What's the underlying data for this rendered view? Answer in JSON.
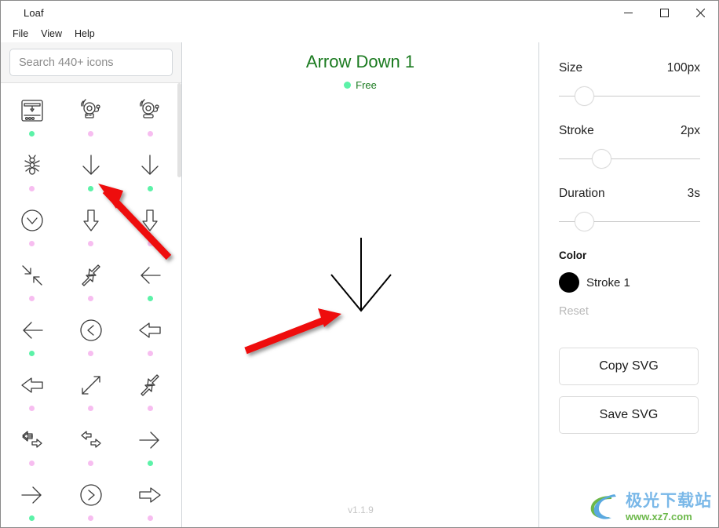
{
  "window": {
    "title": "Loaf",
    "controls": {
      "minimize": "─",
      "maximize": "□",
      "close": "✕"
    }
  },
  "menubar": {
    "items": [
      {
        "label": "File",
        "name": "menu-file"
      },
      {
        "label": "View",
        "name": "menu-view"
      },
      {
        "label": "Help",
        "name": "menu-help"
      }
    ]
  },
  "sidebar": {
    "search": {
      "placeholder": "Search 440+ icons",
      "value": ""
    },
    "icons": [
      {
        "name": "3d-printer-icon",
        "tier": "free"
      },
      {
        "name": "alarm-bell-icon",
        "tier": "pro"
      },
      {
        "name": "alarm-bell-2-icon",
        "tier": "pro"
      },
      {
        "name": "ant-icon",
        "tier": "pro"
      },
      {
        "name": "arrow-down-1-icon",
        "tier": "free"
      },
      {
        "name": "arrow-down-2-icon",
        "tier": "free"
      },
      {
        "name": "arrow-down-circle-icon",
        "tier": "pro"
      },
      {
        "name": "arrow-down-block-icon",
        "tier": "pro"
      },
      {
        "name": "arrow-down-block-2-icon",
        "tier": "pro"
      },
      {
        "name": "arrow-collapse-diagonal-icon",
        "tier": "pro"
      },
      {
        "name": "arrow-expand-diagonal-block-icon",
        "tier": "pro"
      },
      {
        "name": "arrow-left-1-icon",
        "tier": "free"
      },
      {
        "name": "arrow-left-2-icon",
        "tier": "free"
      },
      {
        "name": "arrow-left-circle-icon",
        "tier": "pro"
      },
      {
        "name": "arrow-left-block-icon",
        "tier": "pro"
      },
      {
        "name": "arrow-left-block-2-icon",
        "tier": "pro"
      },
      {
        "name": "arrow-expand-diagonal-icon",
        "tier": "pro"
      },
      {
        "name": "arrow-expand-diagonal-2-icon",
        "tier": "pro"
      },
      {
        "name": "arrow-left-right-block-icon",
        "tier": "pro"
      },
      {
        "name": "arrow-left-right-block-2-icon",
        "tier": "pro"
      },
      {
        "name": "arrow-right-1-icon",
        "tier": "free"
      },
      {
        "name": "arrow-right-2-icon",
        "tier": "free"
      },
      {
        "name": "arrow-right-circle-icon",
        "tier": "pro"
      },
      {
        "name": "arrow-right-block-icon",
        "tier": "pro"
      }
    ]
  },
  "preview": {
    "title": "Arrow Down 1",
    "badge": "Free",
    "version": "v1.1.9"
  },
  "panel": {
    "size": {
      "label": "Size",
      "value": "100px",
      "thumb_pct": 18
    },
    "stroke": {
      "label": "Stroke",
      "value": "2px",
      "thumb_pct": 30
    },
    "duration": {
      "label": "Duration",
      "value": "3s",
      "thumb_pct": 18
    },
    "color_section": "Color",
    "color_name": "Stroke 1",
    "color_hex": "#000000",
    "reset": "Reset",
    "copy_svg": "Copy SVG",
    "save_svg": "Save SVG"
  },
  "watermark": {
    "cn": "极光下载站",
    "url": "www.xz7.com"
  },
  "colors": {
    "title_green": "#1a7a1f",
    "free_dot": "#5cf2a8",
    "pro_dot": "#f7bdf0",
    "annotation_red": "#ee1111"
  }
}
